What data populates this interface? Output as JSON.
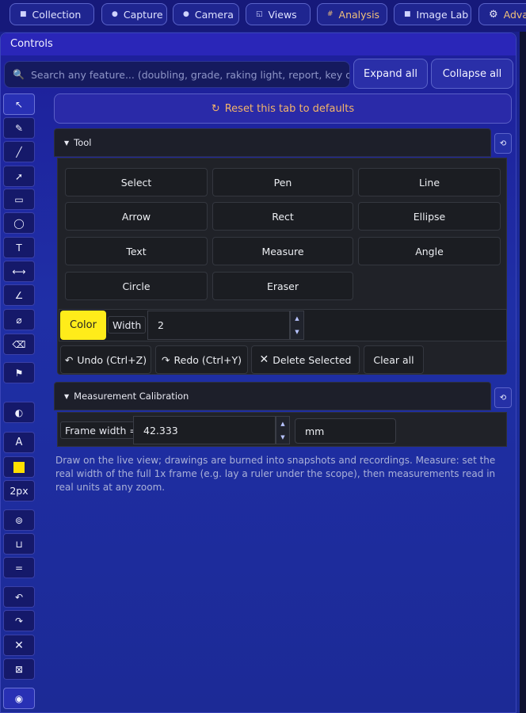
{
  "top_tabs": [
    {
      "label": "Collection",
      "icon": "grid-icon"
    },
    {
      "label": "Capture",
      "icon": "dot-icon"
    },
    {
      "label": "Camera",
      "icon": "dot-icon"
    },
    {
      "label": "Views",
      "icon": "views-icon"
    },
    {
      "label": "Analysis",
      "icon": "hash-icon"
    },
    {
      "label": "Image Lab",
      "icon": "square-icon"
    },
    {
      "label": "Advar",
      "icon": "gear-icon"
    }
  ],
  "panel": {
    "title": "Controls",
    "search_placeholder": "Search any feature... (doubling, grade, raking light, report, key dates)",
    "expand_all": "Expand all",
    "collapse_all": "Collapse all",
    "reset_tab": "Reset this tab to defaults"
  },
  "left_toolbar": [
    "↖",
    "✎",
    "╱",
    "➚",
    "▭",
    "◯",
    "T",
    "⟷",
    "∠",
    "⌀",
    "⌫",
    "⚑",
    "◐",
    "A",
    "",
    "2px",
    "⊚",
    "⊔",
    "=",
    "↶",
    "↷",
    "✕",
    "⊠",
    "◉"
  ],
  "tool_section": {
    "title": "Tool",
    "tools": [
      "Select",
      "Pen",
      "Line",
      "Arrow",
      "Rect",
      "Ellipse",
      "Text",
      "Measure",
      "Angle",
      "Circle",
      "Eraser"
    ],
    "color_label": "Color",
    "width_label": "Width",
    "width_value": "2",
    "undo": "Undo (Ctrl+Z)",
    "redo": "Redo (Ctrl+Y)",
    "delete_selected": "Delete Selected",
    "clear_all": "Clear all"
  },
  "calibration": {
    "title": "Measurement Calibration",
    "frame_label": "Frame width =",
    "frame_value": "42.333",
    "unit": "mm"
  },
  "help_text": "Draw on the live view; drawings are burned into snapshots and recordings. Measure: set the real width of the full 1x frame (e.g. lay a ruler under the scope), then measurements read in real units at any zoom.",
  "colors": {
    "accent_yellow": "#ffec1a",
    "reset_orange": "#f3b46a"
  }
}
